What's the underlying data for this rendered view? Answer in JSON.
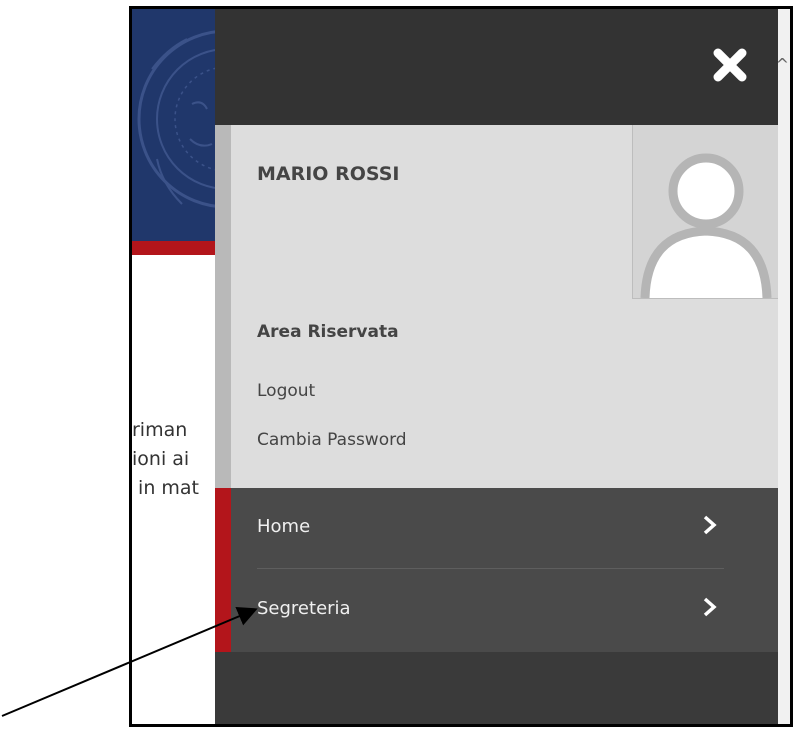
{
  "background_page": {
    "text_lines": [
      "riman",
      "ioni ai",
      " in mat"
    ]
  },
  "panel": {
    "close_icon": "close-icon",
    "user": {
      "name": "MARIO ROSSI",
      "avatar_icon": "user-avatar-icon"
    },
    "area": {
      "title": "Area Riservata",
      "logout": "Logout",
      "change_password": "Cambia Password"
    },
    "nav": {
      "items": [
        {
          "label": "Home",
          "icon": "chevron-right-icon"
        },
        {
          "label": "Segreteria",
          "icon": "chevron-right-icon"
        }
      ]
    }
  },
  "colors": {
    "panel_dark": "#333333",
    "nav_bg": "#4a4a4a",
    "accent_red": "#b3151b",
    "user_block": "#dddddd",
    "header_blue": "#20376b"
  }
}
